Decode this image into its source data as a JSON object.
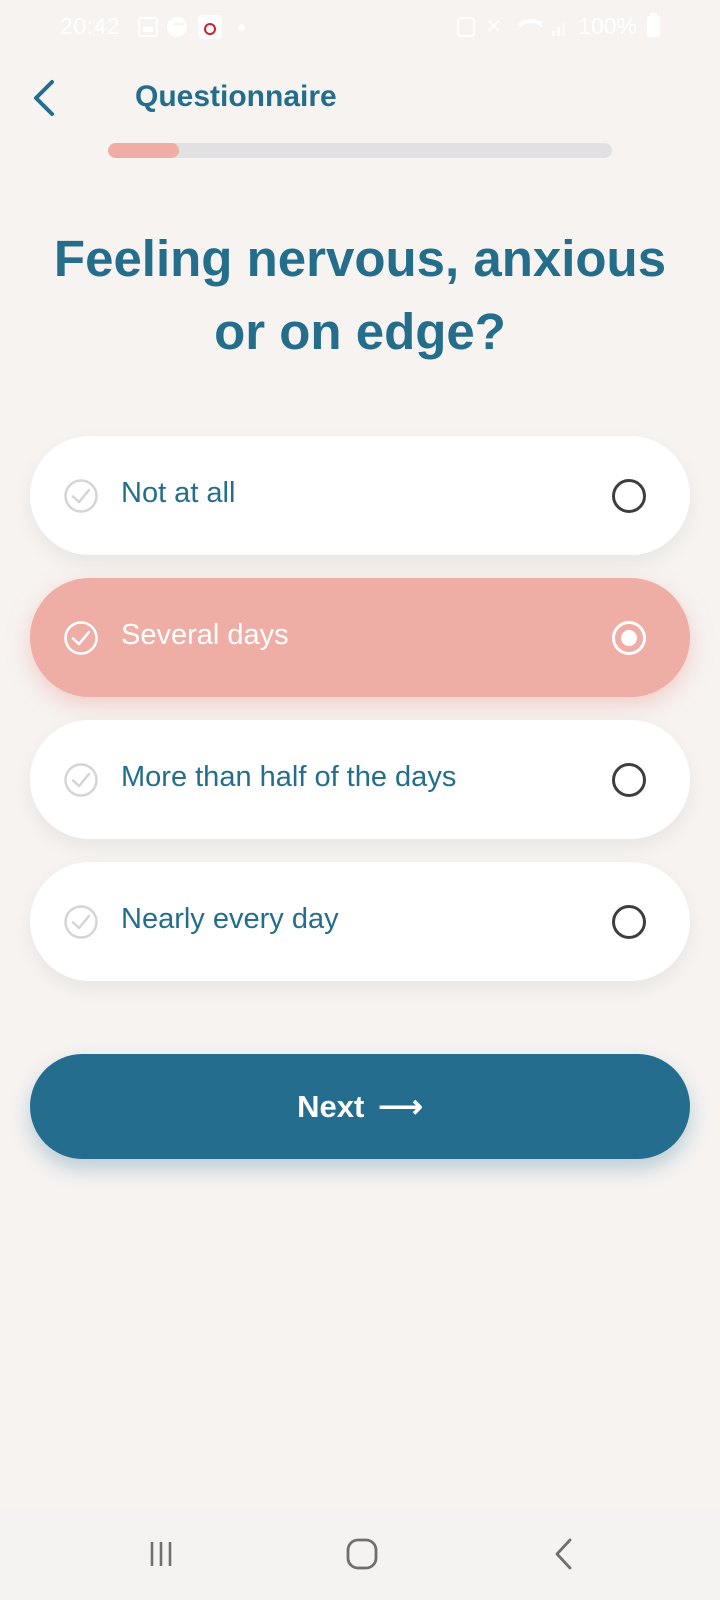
{
  "status_bar": {
    "time": "20:42",
    "battery": "100%",
    "icons": [
      "gallery-icon",
      "messenger-icon",
      "app-notification-icon",
      "dot-icon",
      "nfc-icon",
      "mute-icon",
      "wifi-icon",
      "signal-icon",
      "battery-icon"
    ]
  },
  "header": {
    "title": "Questionnaire",
    "back_icon": "chevron-left-icon"
  },
  "progress": {
    "fraction": 0.14,
    "fill_color": "#eeaea6",
    "track_color": "#e2e1e1"
  },
  "question": {
    "line1": "Feeling nervous, anxious",
    "line2": "or on edge?"
  },
  "options": [
    {
      "label": "Not at all",
      "selected": false
    },
    {
      "label": "Several days",
      "selected": true
    },
    {
      "label": "More than half of the days",
      "selected": false
    },
    {
      "label": "Nearly every day",
      "selected": false
    }
  ],
  "next_button": {
    "label": "Next",
    "arrow": "⟶"
  },
  "colors": {
    "primary": "#256d8e",
    "accent": "#eeaea6",
    "background": "#f6f3f1"
  },
  "nav_bar": {
    "icons": [
      "recents-icon",
      "home-icon",
      "back-icon"
    ]
  }
}
